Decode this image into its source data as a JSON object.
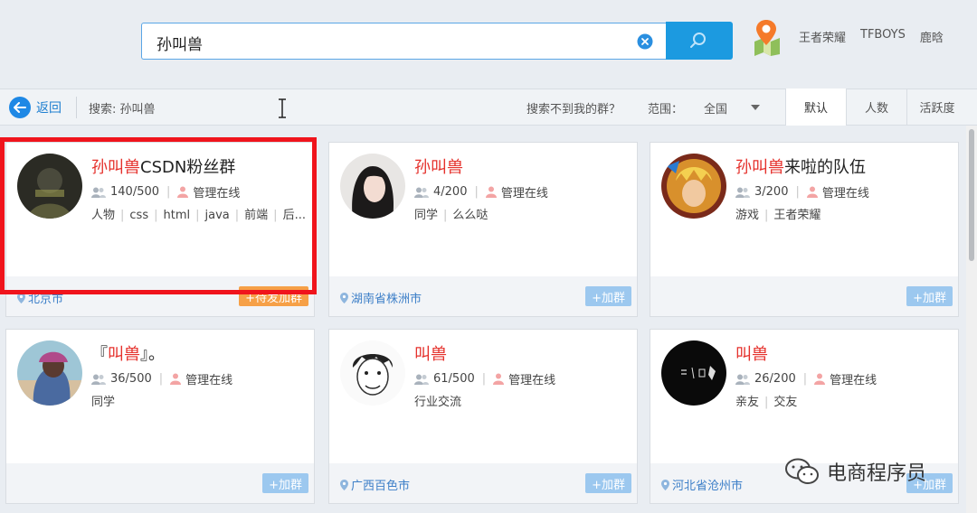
{
  "search": {
    "query": "孙叫兽"
  },
  "hot_tags": [
    "王者荣耀",
    "TFBOYS",
    "鹿晗"
  ],
  "filter": {
    "back_label": "返回",
    "search_label": "搜索: 孙叫兽",
    "notfound_label": "搜索不到我的群？",
    "range_label": "范围：",
    "range_value": "全国",
    "sort_tabs": [
      "默认",
      "人数",
      "活跃度"
    ]
  },
  "groups": [
    {
      "title_hl": "孙叫兽",
      "title_rest": "CSDN粉丝群",
      "members": "140/500",
      "admin": "管理在线",
      "tags": [
        "人物",
        "css",
        "html",
        "java",
        "前端",
        "后..."
      ],
      "location": "北京市",
      "action": "+待发加群"
    },
    {
      "title_hl": "孙叫兽",
      "title_rest": "",
      "members": "4/200",
      "admin": "管理在线",
      "tags": [
        "同学",
        "么么哒"
      ],
      "location": "湖南省株洲市",
      "action": "+加群"
    },
    {
      "title_hl": "孙叫兽",
      "title_rest": "来啦的队伍",
      "members": "3/200",
      "admin": "管理在线",
      "tags": [
        "游戏",
        "王者荣耀"
      ],
      "location": "",
      "action": "+加群"
    },
    {
      "title_pre": "『",
      "title_hl": "叫兽",
      "title_rest": "』。",
      "members": "36/500",
      "admin": "管理在线",
      "tags": [
        "同学"
      ],
      "location": "",
      "action": "+加群"
    },
    {
      "title_hl": "叫兽",
      "title_rest": "",
      "members": "61/500",
      "admin": "管理在线",
      "tags": [
        "行业交流"
      ],
      "location": "广西百色市",
      "action": "+加群"
    },
    {
      "title_hl": "叫兽",
      "title_rest": "",
      "members": "26/200",
      "admin": "管理在线",
      "tags": [
        "亲友",
        "交友"
      ],
      "location": "河北省沧州市",
      "action": "+加群"
    }
  ],
  "watermark": "电商程序员",
  "colors": {
    "accent": "#1c9ae0",
    "highlight": "#e5302b",
    "frame": "#f0141c"
  }
}
